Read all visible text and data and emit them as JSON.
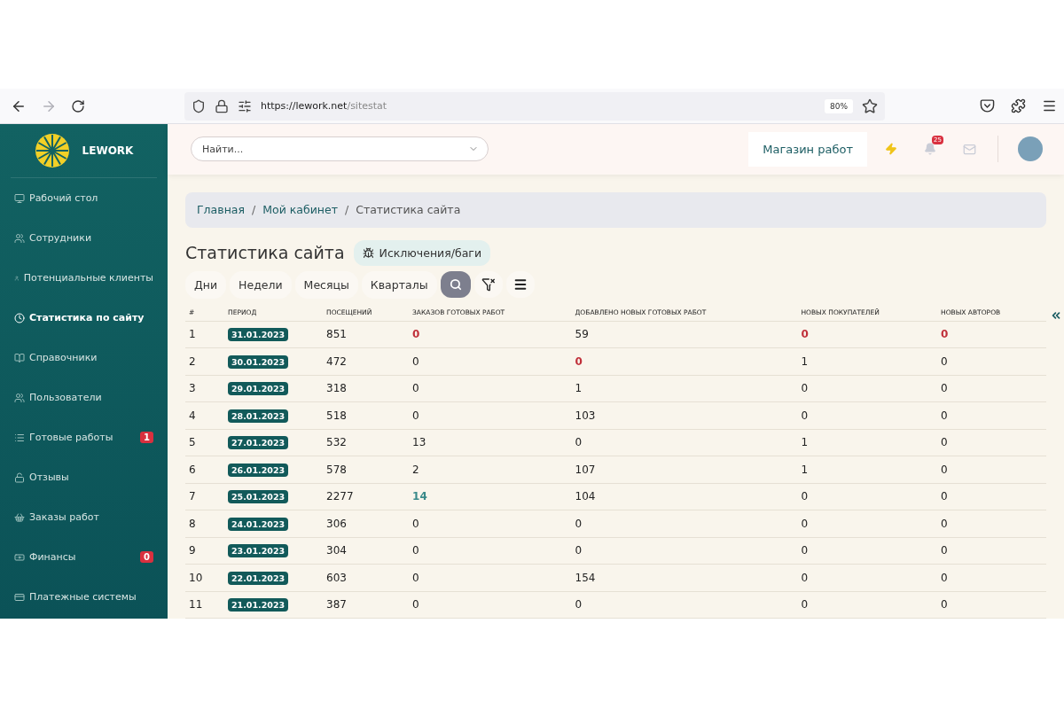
{
  "browser": {
    "url_host": "https://lework.net",
    "url_path": "/sitestat",
    "zoom": "80%"
  },
  "sidebar": {
    "brand": "LEWORK",
    "items": [
      {
        "label": "Рабочий стол",
        "selected": false
      },
      {
        "label": "Сотрудники",
        "selected": false
      },
      {
        "label": "Потенциальные клиенты",
        "selected": false
      },
      {
        "label": "Статистика по сайту",
        "selected": true
      },
      {
        "label": "Справочники",
        "selected": false
      },
      {
        "label": "Пользователи",
        "selected": false
      },
      {
        "label": "Готовые работы",
        "selected": false,
        "badge": "1"
      },
      {
        "label": "Отзывы",
        "selected": false
      },
      {
        "label": "Заказы работ",
        "selected": false
      },
      {
        "label": "Финансы",
        "selected": false,
        "badge": "0"
      },
      {
        "label": "Платежные системы",
        "selected": false
      }
    ]
  },
  "header": {
    "search": {
      "placeholder": "Найти..."
    },
    "shop_link": "Магазин работ",
    "notifications": "25"
  },
  "breadcrumbs": [
    {
      "text": "Главная",
      "kind": "link"
    },
    {
      "text": "/",
      "kind": "separator"
    },
    {
      "text": "Мой кабинет",
      "kind": "link"
    },
    {
      "text": "/",
      "kind": "separator"
    },
    {
      "text": "Статистика сайта",
      "kind": "current"
    }
  ],
  "page_title": "Статистика сайта",
  "bugs_button": "Исключения/баги",
  "period_tabs": [
    {
      "label": "Дни",
      "selected": false
    },
    {
      "label": "Недели",
      "selected": false
    },
    {
      "label": "Месяцы",
      "selected": false
    },
    {
      "label": "Кварталы",
      "selected": false
    }
  ],
  "table": {
    "columns": [
      "#",
      "ПЕРИОД",
      "ПОСЕЩЕНИЙ",
      "ЗАКАЗОВ ГОТОВЫХ РАБОТ",
      "ДОБАВЛЕНО НОВЫХ ГОТОВЫХ РАБОТ",
      "НОВЫХ ПОКУПАТЕЛЕЙ",
      "НОВЫХ АВТОРОВ"
    ],
    "rows": [
      {
        "cells": [
          {
            "text": "1",
            "kind": "index"
          },
          {
            "text": "31.01.2023",
            "kind": "date"
          },
          {
            "text": "851",
            "kind": "plain"
          },
          {
            "text": "0",
            "kind": "alert"
          },
          {
            "text": "59",
            "kind": "plain"
          },
          {
            "text": "0",
            "kind": "alert"
          },
          {
            "text": "0",
            "kind": "alert"
          }
        ]
      },
      {
        "cells": [
          {
            "text": "2",
            "kind": "index"
          },
          {
            "text": "30.01.2023",
            "kind": "date"
          },
          {
            "text": "472",
            "kind": "plain"
          },
          {
            "text": "0",
            "kind": "plain"
          },
          {
            "text": "0",
            "kind": "alert"
          },
          {
            "text": "1",
            "kind": "plain"
          },
          {
            "text": "0",
            "kind": "plain"
          }
        ]
      },
      {
        "cells": [
          {
            "text": "3",
            "kind": "index"
          },
          {
            "text": "29.01.2023",
            "kind": "date"
          },
          {
            "text": "318",
            "kind": "plain"
          },
          {
            "text": "0",
            "kind": "plain"
          },
          {
            "text": "1",
            "kind": "plain"
          },
          {
            "text": "0",
            "kind": "plain"
          },
          {
            "text": "0",
            "kind": "plain"
          }
        ]
      },
      {
        "cells": [
          {
            "text": "4",
            "kind": "index"
          },
          {
            "text": "28.01.2023",
            "kind": "date"
          },
          {
            "text": "518",
            "kind": "plain"
          },
          {
            "text": "0",
            "kind": "plain"
          },
          {
            "text": "103",
            "kind": "plain"
          },
          {
            "text": "0",
            "kind": "plain"
          },
          {
            "text": "0",
            "kind": "plain"
          }
        ]
      },
      {
        "cells": [
          {
            "text": "5",
            "kind": "index"
          },
          {
            "text": "27.01.2023",
            "kind": "date"
          },
          {
            "text": "532",
            "kind": "plain"
          },
          {
            "text": "13",
            "kind": "plain"
          },
          {
            "text": "0",
            "kind": "plain"
          },
          {
            "text": "1",
            "kind": "plain"
          },
          {
            "text": "0",
            "kind": "plain"
          }
        ]
      },
      {
        "cells": [
          {
            "text": "6",
            "kind": "index"
          },
          {
            "text": "26.01.2023",
            "kind": "date"
          },
          {
            "text": "578",
            "kind": "plain"
          },
          {
            "text": "2",
            "kind": "plain"
          },
          {
            "text": "107",
            "kind": "plain"
          },
          {
            "text": "1",
            "kind": "plain"
          },
          {
            "text": "0",
            "kind": "plain"
          }
        ]
      },
      {
        "cells": [
          {
            "text": "7",
            "kind": "index"
          },
          {
            "text": "25.01.2023",
            "kind": "date"
          },
          {
            "text": "2277",
            "kind": "plain"
          },
          {
            "text": "14",
            "kind": "highlight"
          },
          {
            "text": "104",
            "kind": "plain"
          },
          {
            "text": "0",
            "kind": "plain"
          },
          {
            "text": "0",
            "kind": "plain"
          }
        ]
      },
      {
        "cells": [
          {
            "text": "8",
            "kind": "index"
          },
          {
            "text": "24.01.2023",
            "kind": "date"
          },
          {
            "text": "306",
            "kind": "plain"
          },
          {
            "text": "0",
            "kind": "plain"
          },
          {
            "text": "0",
            "kind": "plain"
          },
          {
            "text": "0",
            "kind": "plain"
          },
          {
            "text": "0",
            "kind": "plain"
          }
        ]
      },
      {
        "cells": [
          {
            "text": "9",
            "kind": "index"
          },
          {
            "text": "23.01.2023",
            "kind": "date"
          },
          {
            "text": "304",
            "kind": "plain"
          },
          {
            "text": "0",
            "kind": "plain"
          },
          {
            "text": "0",
            "kind": "plain"
          },
          {
            "text": "0",
            "kind": "plain"
          },
          {
            "text": "0",
            "kind": "plain"
          }
        ]
      },
      {
        "cells": [
          {
            "text": "10",
            "kind": "index"
          },
          {
            "text": "22.01.2023",
            "kind": "date"
          },
          {
            "text": "603",
            "kind": "plain"
          },
          {
            "text": "0",
            "kind": "plain"
          },
          {
            "text": "154",
            "kind": "plain"
          },
          {
            "text": "0",
            "kind": "plain"
          },
          {
            "text": "0",
            "kind": "plain"
          }
        ]
      },
      {
        "cells": [
          {
            "text": "11",
            "kind": "index"
          },
          {
            "text": "21.01.2023",
            "kind": "date"
          },
          {
            "text": "387",
            "kind": "plain"
          },
          {
            "text": "0",
            "kind": "plain"
          },
          {
            "text": "0",
            "kind": "plain"
          },
          {
            "text": "0",
            "kind": "plain"
          },
          {
            "text": "0",
            "kind": "plain"
          }
        ]
      }
    ]
  }
}
